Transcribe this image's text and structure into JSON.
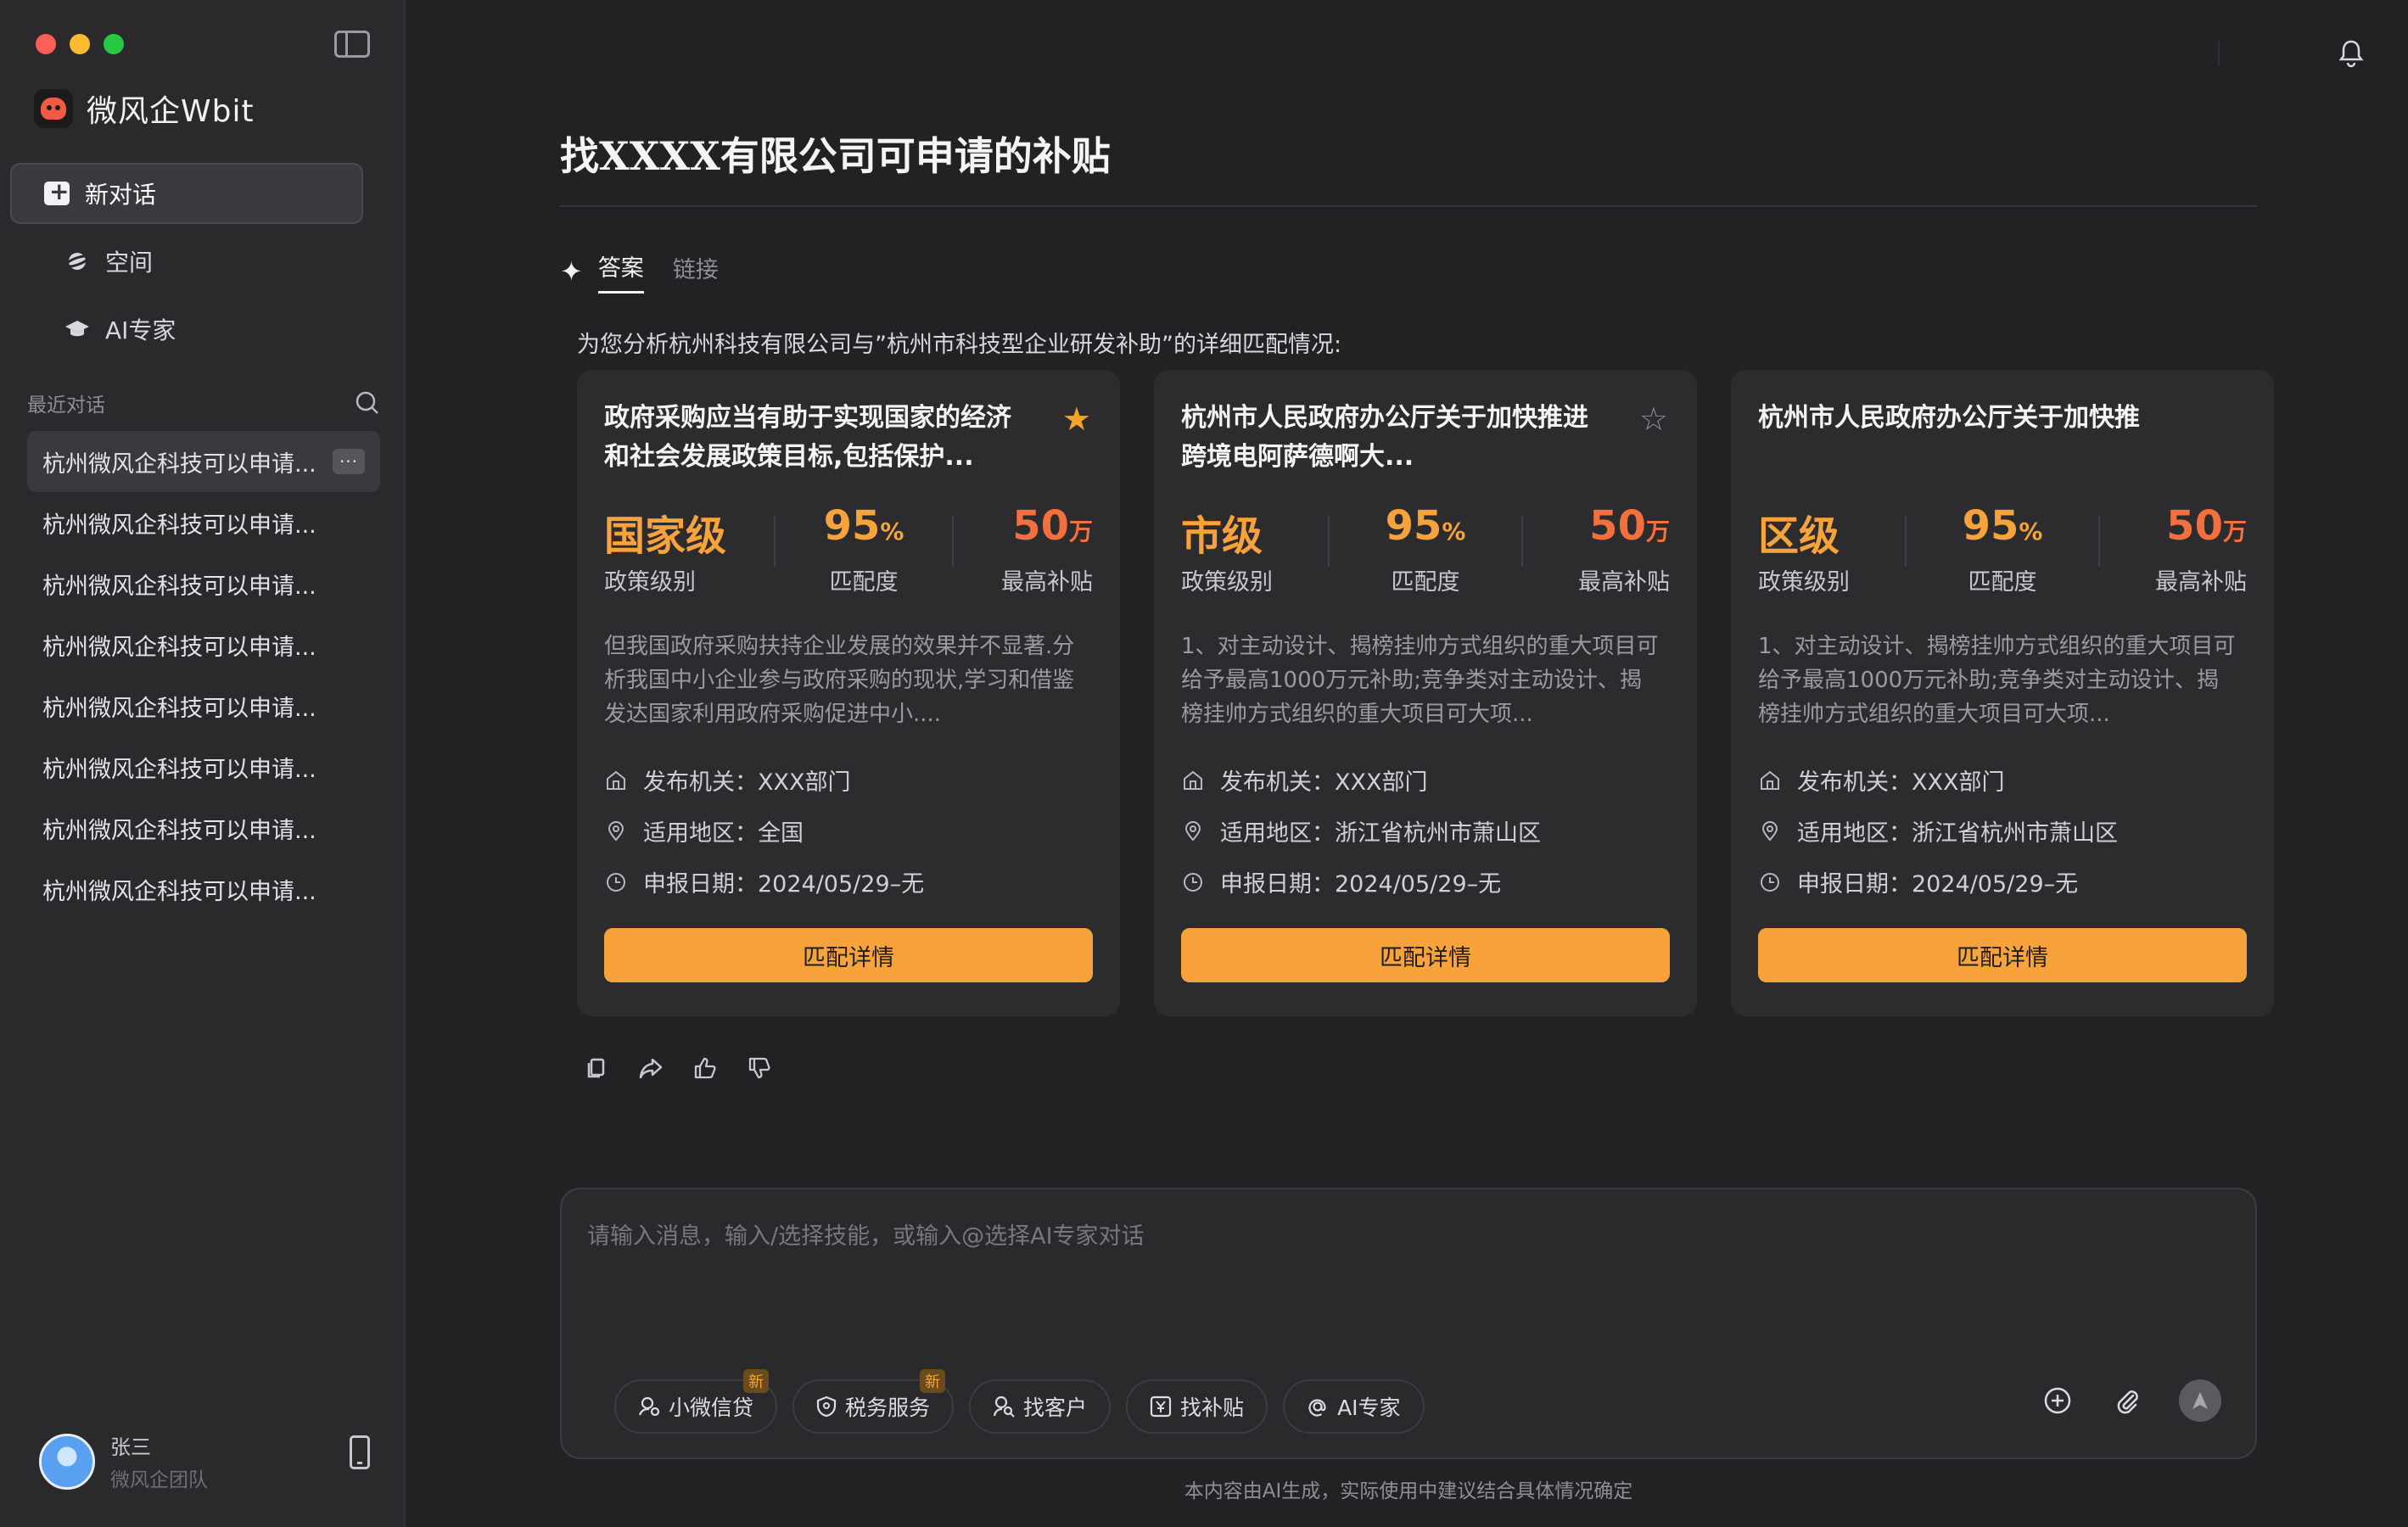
{
  "app": {
    "name": "微风企Wbit"
  },
  "sidebar": {
    "new_chat": "新对话",
    "nav": [
      {
        "label": "空间",
        "icon": "planet-icon"
      },
      {
        "label": "AI专家",
        "icon": "graduation-cap-icon"
      }
    ],
    "recent_title": "最近对话",
    "recent": [
      "杭州微风企科技可以申请...",
      "杭州微风企科技可以申请...",
      "杭州微风企科技可以申请...",
      "杭州微风企科技可以申请...",
      "杭州微风企科技可以申请...",
      "杭州微风企科技可以申请...",
      "杭州微风企科技可以申请...",
      "杭州微风企科技可以申请..."
    ],
    "more_label": "···",
    "user": {
      "name": "张三",
      "team": "微风企团队"
    }
  },
  "main": {
    "title": "找XXXX有限公司可申请的补贴",
    "tabs": [
      "答案",
      "链接"
    ],
    "intro": "为您分析杭州科技有限公司与”杭州市科技型企业研发补助”的详细匹配情况:",
    "cards": [
      {
        "title": "政府采购应当有助于实现国家的经济和社会发展政策目标,包括保护...",
        "starred": true,
        "level": "国家级",
        "level_label": "政策级别",
        "match": "95",
        "match_unit": "%",
        "match_label": "匹配度",
        "amount": "50",
        "amount_unit": "万",
        "amount_label": "最高补贴",
        "desc": "但我国政府采购扶持企业发展的效果并不显著.分析我国中小企业参与政府采购的现状,学习和借鉴发达国家利用政府采购促进中小....",
        "issuer": "发布机关：XXX部门",
        "region": "适用地区：全国",
        "date": "申报日期：2024/05/29–无",
        "button": "匹配详情"
      },
      {
        "title": "杭州市人民政府办公厅关于加快推进跨境电阿萨德啊大...",
        "starred": false,
        "level": "市级",
        "level_label": "政策级别",
        "match": "95",
        "match_unit": "%",
        "match_label": "匹配度",
        "amount": "50",
        "amount_unit": "万",
        "amount_label": "最高补贴",
        "desc": "1、对主动设计、揭榜挂帅方式组织的重大项目可给予最高1000万元补助;竞争类对主动设计、揭榜挂帅方式组织的重大项目可大项...",
        "issuer": "发布机关：XXX部门",
        "region": "适用地区：浙江省杭州市萧山区",
        "date": "申报日期：2024/05/29–无",
        "button": "匹配详情"
      },
      {
        "title": "杭州市人民政府办公厅关于加快推",
        "starred": null,
        "level": "区级",
        "level_label": "政策级别",
        "match": "95",
        "match_unit": "%",
        "match_label": "匹配度",
        "amount": "50",
        "amount_unit": "万",
        "amount_label": "最高补贴",
        "desc": "1、对主动设计、揭榜挂帅方式组织的重大项目可给予最高1000万元补助;竞争类对主动设计、揭榜挂帅方式组织的重大项目可大项...",
        "issuer": "发布机关：XXX部门",
        "region": "适用地区：浙江省杭州市萧山区",
        "date": "申报日期：2024/05/29–无",
        "button": "匹配详情"
      }
    ]
  },
  "composer": {
    "placeholder": "请输入消息，输入/选择技能，或输入@选择AI专家对话",
    "chips": [
      {
        "label": "小微信贷",
        "badge": "新",
        "icon": "loan-icon"
      },
      {
        "label": "税务服务",
        "badge": "新",
        "icon": "shield-icon"
      },
      {
        "label": "找客户",
        "badge": "",
        "icon": "user-search-icon"
      },
      {
        "label": "找补贴",
        "badge": "",
        "icon": "yen-icon"
      },
      {
        "label": "AI专家",
        "badge": "",
        "icon": "at-icon"
      }
    ],
    "disclaimer": "本内容由AI生成，实际使用中建议结合具体情况确定"
  },
  "colors": {
    "accent": "#f7a23a",
    "accent_red": "#f2703e",
    "star": "#f5a524"
  }
}
